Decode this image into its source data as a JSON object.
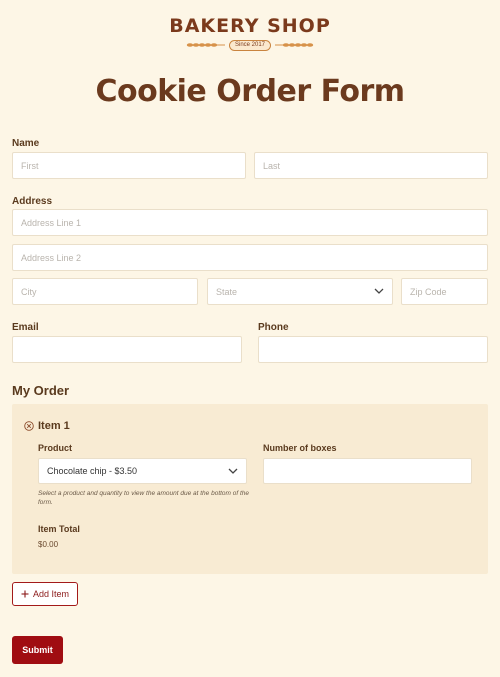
{
  "brand": {
    "name": "BAKERY SHOP",
    "since": "Since 2017"
  },
  "page_title": "Cookie Order Form",
  "name_section": {
    "label": "Name",
    "first_placeholder": "First",
    "last_placeholder": "Last"
  },
  "address_section": {
    "label": "Address",
    "line1_placeholder": "Address Line 1",
    "line2_placeholder": "Address Line 2",
    "city_placeholder": "City",
    "state_placeholder": "State",
    "zip_placeholder": "Zip Code"
  },
  "email_label": "Email",
  "phone_label": "Phone",
  "order": {
    "section_title": "My Order",
    "item_title": "Item 1",
    "product_label": "Product",
    "product_value": "Chocolate chip - $3.50",
    "boxes_label": "Number of boxes",
    "helper_text": "Select a product and quantity to view the amount due at the bottom of the form.",
    "item_total_label": "Item Total",
    "item_total_value": "$0.00"
  },
  "add_item_label": "Add Item",
  "submit_label": "Submit",
  "colors": {
    "background": "#fdf6e6",
    "brand": "#7b3a1c",
    "accent": "#a00d12",
    "card": "#f8ebd3"
  },
  "icons": {
    "wheat": "wheat-icon",
    "remove": "close-circle-icon",
    "dropdown": "chevron-down-icon",
    "add": "plus-icon"
  }
}
